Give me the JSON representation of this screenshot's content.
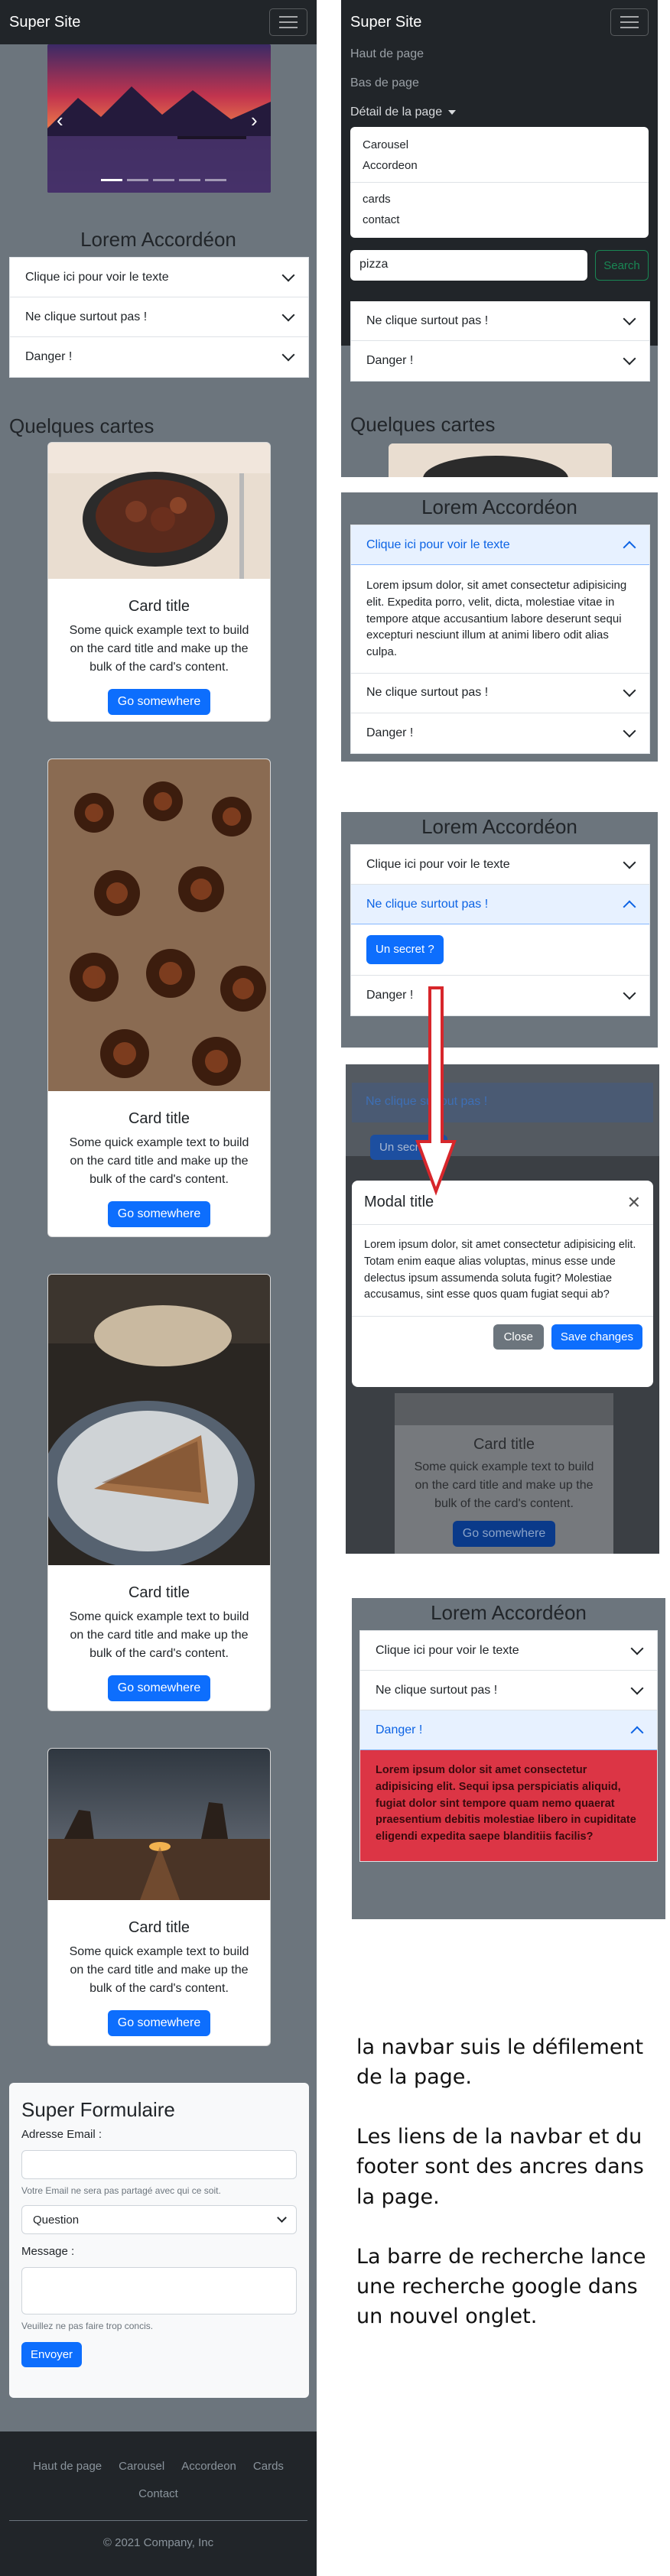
{
  "navbar": {
    "brand": "Super Site"
  },
  "menu": {
    "links": [
      "Haut de page",
      "Bas de page",
      "Détail de la page"
    ],
    "dropdown_items": [
      "Carousel",
      "Accordeon",
      "cards",
      "contact"
    ],
    "search_value": "pizza",
    "search_button": "Search"
  },
  "accordion": {
    "title": "Lorem Accordéon",
    "items": [
      "Clique ici pour voir le texte",
      "Ne clique surtout pas !",
      "Danger !"
    ],
    "item1_body": "Lorem ipsum dolor, sit amet consectetur adipisicing elit. Expedita porro, velit, dicta, molestiae vitae in tempore atque accusantium labore deserunt sequi excepturi nesciunt illum at animi libero odit alias culpa.",
    "secret_button": "Un secret ?",
    "danger_body": "Lorem ipsum dolor sit amet consectetur adipisicing elit. Sequi ipsa perspiciatis aliquid, fugiat dolor sint tempore quam nemo quaerat praesentium debitis molestiae libero in cupiditate eligendi expedita saepe blanditiis facilis?"
  },
  "cards_section": {
    "title": "Quelques cartes",
    "card_title": "Card title",
    "card_text": "Some quick example text to build on the card title and make up the bulk of the card's content.",
    "card_button": "Go somewhere"
  },
  "modal": {
    "title": "Modal title",
    "body": "Lorem ipsum dolor, sit amet consectetur adipisicing elit. Totam enim eaque alias voluptas, minus esse unde delectus ipsum assumenda soluta fugit? Molestiae accusamus, sint esse quos quam fugiat sequi ab?",
    "close": "Close",
    "save": "Save changes"
  },
  "form": {
    "title": "Super Formulaire",
    "email_label": "Adresse Email :",
    "email_help": "Votre Email ne sera pas partagé avec qui ce soit.",
    "select_value": "Question",
    "message_label": "Message :",
    "message_help": "Veuillez ne pas faire trop concis.",
    "submit": "Envoyer"
  },
  "footer": {
    "links": [
      "Haut de page",
      "Carousel",
      "Accordeon",
      "Cards",
      "Contact"
    ],
    "copyright": "© 2021 Company, Inc"
  },
  "notes": {
    "p1": "la navbar suis le défilement de la page.",
    "p2": "Les liens de la navbar et du footer sont des ancres dans la page.",
    "p3": "La barre de recherche lance une recherche google dans un nouvel onglet."
  },
  "colors": {
    "primary": "#0d6efd",
    "dark": "#212529",
    "page_gray": "#6c757d",
    "danger": "#dc3545"
  }
}
